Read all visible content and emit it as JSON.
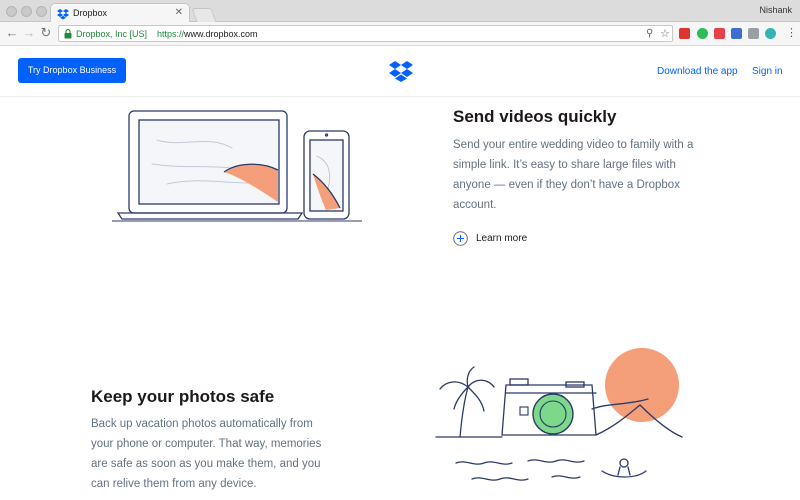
{
  "browser": {
    "tab_title": "Dropbox",
    "tab_close": "✕",
    "profile_name": "Nishank",
    "cert_label": "Dropbox, Inc [US]",
    "url_scheme": "https://",
    "url_host": "www.dropbox.com",
    "back_glyph": "←",
    "forward_glyph": "→",
    "reload_glyph": "↻",
    "menu_glyph": "⋮",
    "key_glyph": "⚲",
    "star_glyph": "☆"
  },
  "header": {
    "business_button": "Try Dropbox Business",
    "download_link": "Download the app",
    "signin_link": "Sign in"
  },
  "sections": {
    "videos": {
      "title": "Send videos quickly",
      "lines": [
        "Send your entire wedding video to family with a",
        "simple link. It’s easy to share large files with",
        "anyone — even if they don’t have a Dropbox",
        "account."
      ],
      "learn_more": "Learn more"
    },
    "photos": {
      "title": "Keep your photos safe",
      "lines": [
        "Back up vacation photos automatically from",
        "your phone or computer. That way, memories",
        "are safe as soon as you make them, and you",
        "can relive them from any device."
      ]
    }
  },
  "colors": {
    "brand_blue": "#0061fe",
    "accent_salmon": "#f59e7a",
    "accent_green": "#7cd88a",
    "ink": "#2b3a67"
  },
  "icons": {
    "favicon": "dropbox-icon",
    "lock": "lock-icon",
    "logo": "dropbox-logo-icon",
    "learn_more": "plus-circle-icon"
  }
}
